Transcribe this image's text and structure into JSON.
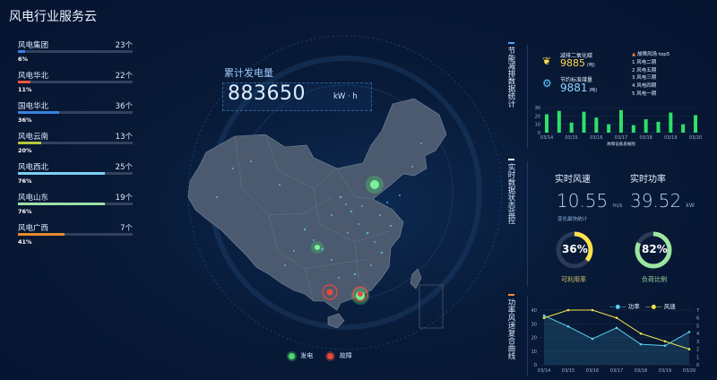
{
  "app_title": "风电行业服务云",
  "left_list": [
    {
      "name": "风电集团",
      "count": "23个",
      "pct": "6%",
      "fill": 0.06,
      "color": "#3a82e0"
    },
    {
      "name": "风电华北",
      "count": "22个",
      "pct": "11%",
      "fill": 0.11,
      "color": "#e8583c"
    },
    {
      "name": "国电华北",
      "count": "36个",
      "pct": "36%",
      "fill": 0.36,
      "color": "#3a82e0"
    },
    {
      "name": "风电云南",
      "count": "13个",
      "pct": "20%",
      "fill": 0.2,
      "color": "#b6c53a"
    },
    {
      "name": "风电西北",
      "count": "25个",
      "pct": "76%",
      "fill": 0.76,
      "color": "#7bd0f2"
    },
    {
      "name": "风电山东",
      "count": "19个",
      "pct": "76%",
      "fill": 0.76,
      "color": "#9de0a8"
    },
    {
      "name": "风电广西",
      "count": "7个",
      "pct": "41%",
      "fill": 0.41,
      "color": "#ea8a2c"
    }
  ],
  "generation": {
    "title": "累计发电量",
    "value": "883650",
    "unit": "kW · h"
  },
  "map_legend": {
    "gen_label": "发电",
    "gen_color": "#50d870",
    "fault_label": "故障",
    "fault_color": "#e84a3a"
  },
  "panel1": {
    "title": "节能减排数据统计",
    "co2_label": "减排二氧化碳",
    "co2_value": "9885",
    "co2_unit": "(吨)",
    "coal_label": "节约标准煤量",
    "coal_value": "9881",
    "coal_unit": "(吨)",
    "fault_top_title": "故障风场 top5",
    "fault_top": [
      "1  风电二期",
      "2  风电五期",
      "3  风电三期",
      "4  风电四期",
      "5  风电一期"
    ],
    "chart_caption": "故障设备发展图"
  },
  "panel2": {
    "title": "实时数据状态监控",
    "wind_label": "实时风速",
    "wind_value": "10.55",
    "wind_unit": "m/s",
    "power_label": "实时功率",
    "power_value": "39.52",
    "power_unit": "kW",
    "note": "变化最快统计",
    "ring1_pct": "36%",
    "ring1_value": 0.36,
    "ring1_label": "可利用率",
    "ring1_color": "#ffe24a",
    "ring2_pct": "82%",
    "ring2_value": 0.82,
    "ring2_label": "负荷比例",
    "ring2_color": "#9de6a0"
  },
  "panel3": {
    "title": "功率风速复合曲线",
    "legend_power": "功率",
    "legend_wind": "风速"
  },
  "chart_data": [
    {
      "type": "bar",
      "title": "故障设备发展图",
      "categories": [
        "03/14",
        "03/15",
        "03/16",
        "03/17",
        "03/18",
        "03/19",
        "03/20"
      ],
      "series": [
        {
          "values": [
            22,
            26,
            12,
            25,
            18,
            10,
            27,
            9,
            16,
            13,
            24,
            10,
            21
          ]
        }
      ],
      "bar_x": [
        "03/14",
        "03/14.5",
        "03/15",
        "03/15.5",
        "03/16",
        "03/16.5",
        "03/17",
        "03/17.5",
        "03/18",
        "03/18.5",
        "03/19",
        "03/19.5",
        "03/20"
      ],
      "yticks": [
        "0",
        "10",
        "20",
        "30"
      ],
      "ylim": [
        0,
        30
      ],
      "bar_color": "#2ee06a"
    },
    {
      "type": "line",
      "title": "",
      "categories": [
        "03/14",
        "03/15",
        "03/16",
        "03/17",
        "03/18",
        "03/19",
        "03/20"
      ],
      "series": [
        {
          "name": "功率",
          "axis": "left",
          "color": "#5ad0f0",
          "values": [
            36,
            28,
            19,
            27,
            15,
            14,
            24
          ]
        },
        {
          "name": "风速",
          "axis": "right",
          "color": "#f5e050",
          "values": [
            6,
            7,
            7,
            6,
            4,
            3,
            2
          ]
        }
      ],
      "yticks_left": [
        "0",
        "10",
        "20",
        "30",
        "40"
      ],
      "ylim_left": [
        0,
        40
      ],
      "yticks_right": [
        "0",
        "1",
        "2",
        "3",
        "4",
        "5",
        "6",
        "7"
      ],
      "ylim_right": [
        0,
        7
      ]
    }
  ]
}
